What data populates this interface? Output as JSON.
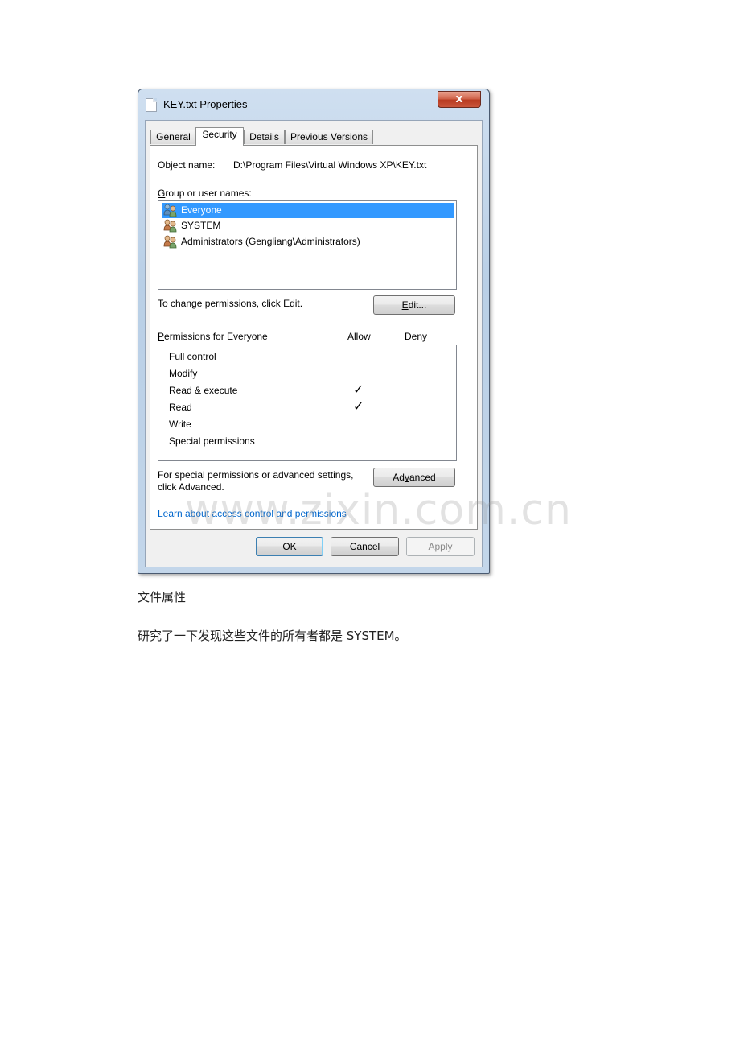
{
  "window": {
    "title": "KEY.txt Properties",
    "close_glyph": "x"
  },
  "tabs": [
    {
      "label": "General"
    },
    {
      "label": "Security"
    },
    {
      "label": "Details"
    },
    {
      "label": "Previous Versions"
    }
  ],
  "security": {
    "object_name_label": "Object name:",
    "object_name_value": "D:\\Program Files\\Virtual Windows XP\\KEY.txt",
    "group_label_first": "G",
    "group_label_rest": "roup or user names:",
    "users": [
      {
        "name": "Everyone",
        "selected": true,
        "icon": "user-group-icon"
      },
      {
        "name": "SYSTEM",
        "selected": false,
        "icon": "user-group-icon"
      },
      {
        "name": "Administrators (Gengliang\\Administrators)",
        "selected": false,
        "icon": "user-group-icon"
      }
    ],
    "change_permissions_text": "To change permissions, click Edit.",
    "edit_button": {
      "accel": "E",
      "rest": "dit..."
    },
    "permissions_label_first": "P",
    "permissions_label_rest": "ermissions for Everyone",
    "allow_header": "Allow",
    "deny_header": "Deny",
    "permissions": [
      {
        "name": "Full control",
        "allow": false,
        "deny": false
      },
      {
        "name": "Modify",
        "allow": false,
        "deny": false
      },
      {
        "name": "Read & execute",
        "allow": true,
        "deny": false
      },
      {
        "name": "Read",
        "allow": true,
        "deny": false
      },
      {
        "name": "Write",
        "allow": false,
        "deny": false
      },
      {
        "name": "Special permissions",
        "allow": false,
        "deny": false
      }
    ],
    "check_glyph": "✓",
    "special_text_line1": "For special permissions or advanced settings,",
    "special_text_line2": "click Advanced.",
    "advanced_button": {
      "pre": "Ad",
      "accel": "v",
      "post": "anced"
    },
    "learn_link": "Learn about access control and permissions"
  },
  "footer": {
    "ok": "OK",
    "cancel": "Cancel",
    "apply_accel": "A",
    "apply_rest": "pply"
  },
  "page": {
    "watermark": "www.zixin.com.cn",
    "caption": "文件属性",
    "paragraph": "研究了一下发现这些文件的所有者都是 SYSTEM。"
  },
  "colors": {
    "selection": "#3399ff",
    "link": "#0066cc",
    "close_button": "#c9553b"
  }
}
